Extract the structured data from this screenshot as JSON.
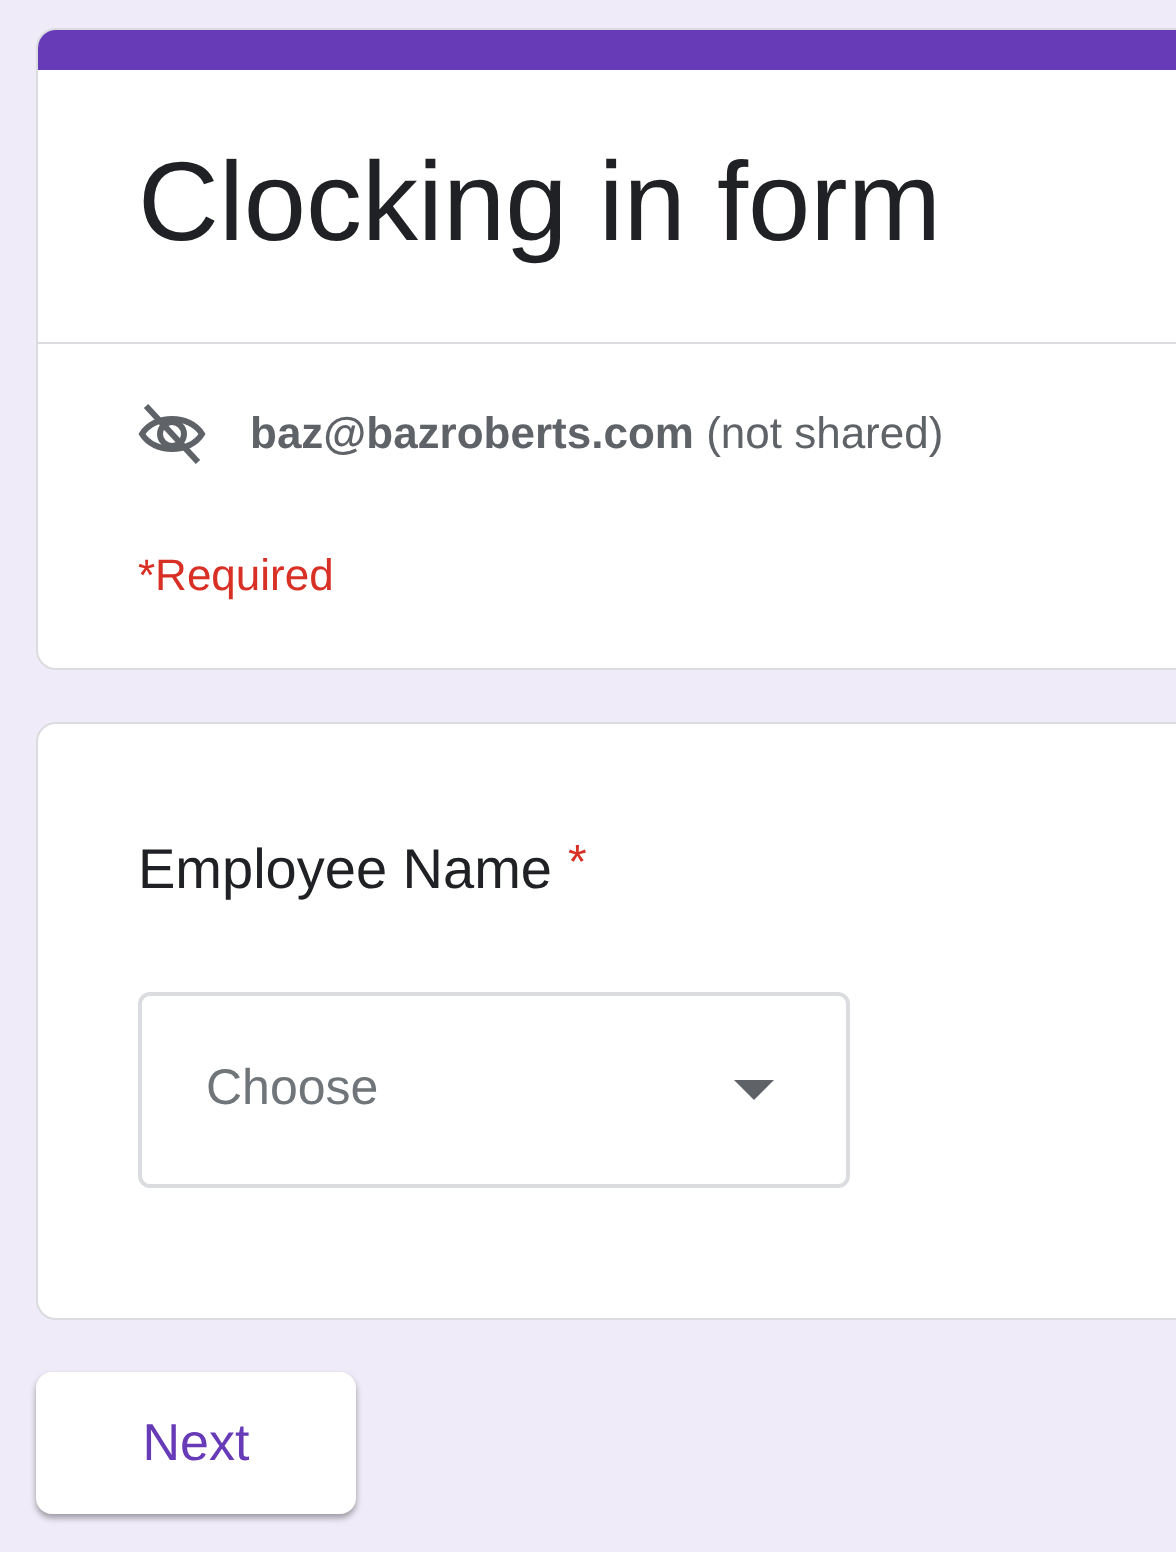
{
  "form": {
    "title": "Clocking in form",
    "account": "**baz@bazroberts.com** (not shared)",
    "required_note": "*Required"
  },
  "question": {
    "label": "Employee Name",
    "required_mark": "*",
    "dropdown": {
      "placeholder": "Choose"
    }
  },
  "buttons": [
    {
      "label": "Next"
    }
  ]
}
